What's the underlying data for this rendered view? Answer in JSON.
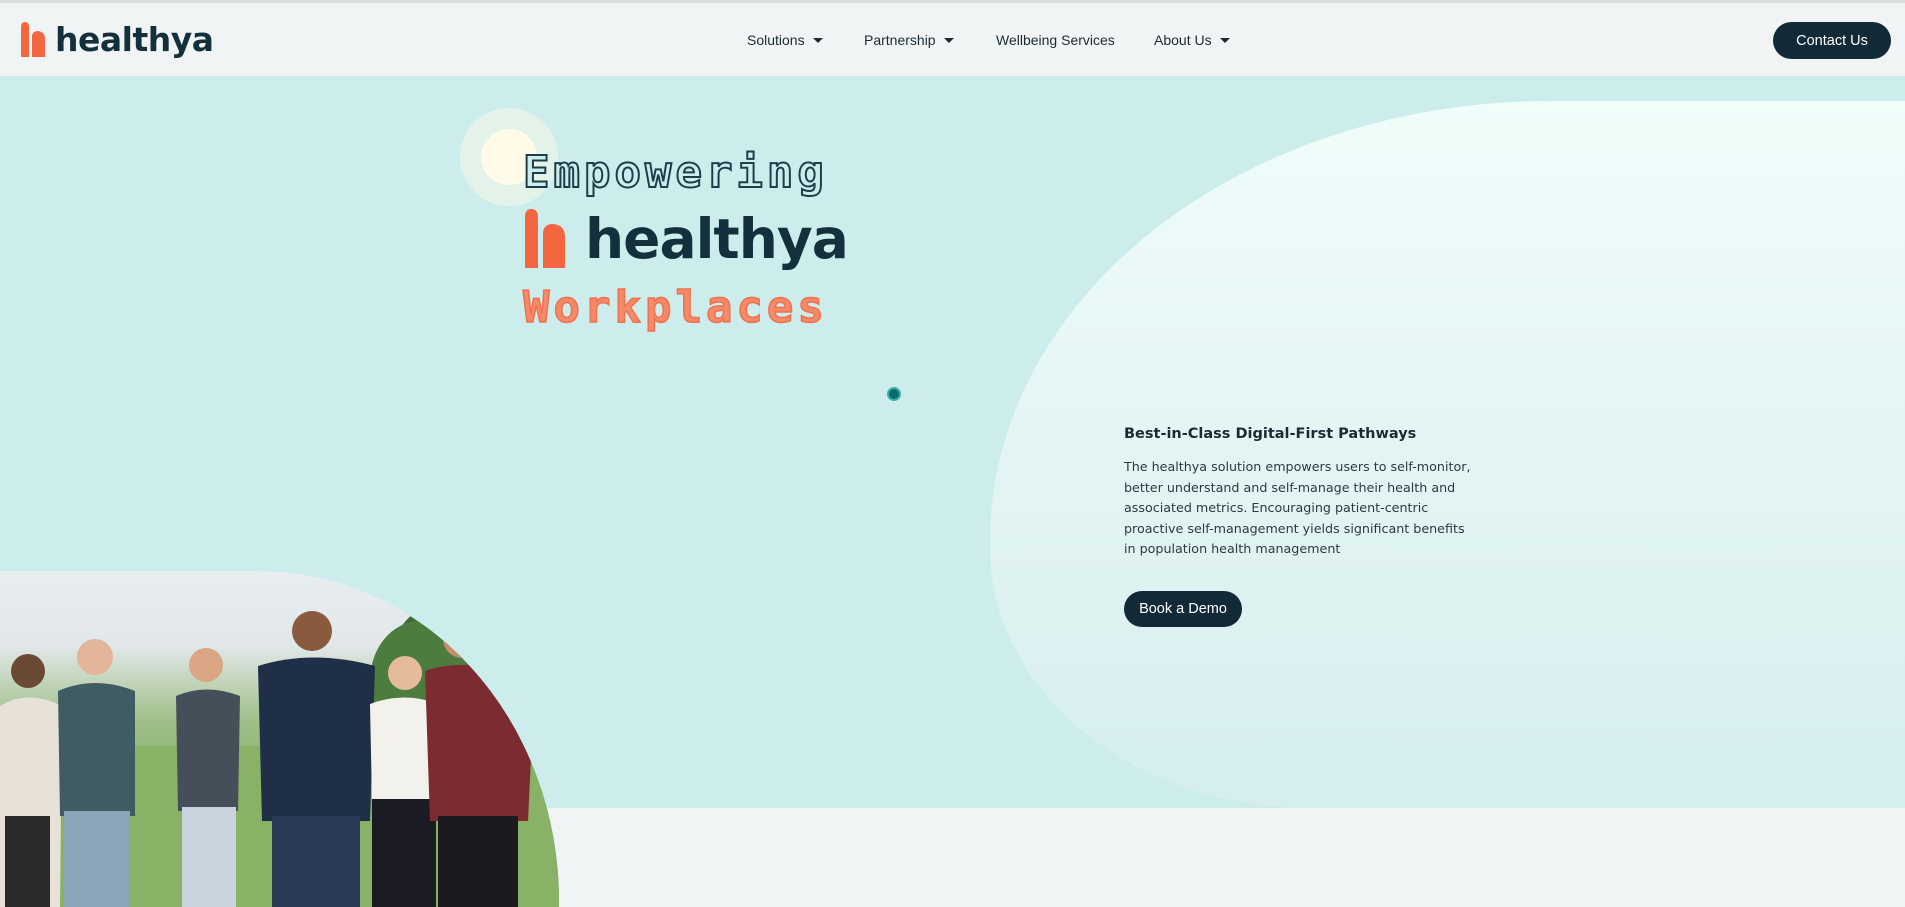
{
  "brand": {
    "name": "healthya",
    "primary": "#122a37",
    "accent": "#f26640",
    "hero_bg": "#cdeded",
    "page_bg": "#f0f4f4"
  },
  "nav": {
    "items": [
      {
        "label": "Solutions",
        "dropdown": true
      },
      {
        "label": "Partnership",
        "dropdown": true
      },
      {
        "label": "Wellbeing Services",
        "dropdown": false
      },
      {
        "label": "About Us",
        "dropdown": true
      }
    ],
    "contact_label": "Contact Us"
  },
  "hero": {
    "line1": "Empowering",
    "brand_line": "healthya",
    "line3": "Workplaces",
    "heading": "Best-in-Class Digital-First Pathways",
    "body": "The healthya solution empowers users to self-monitor, better understand and self-manage their health and associated metrics. Encouraging patient-centric proactive self-management yields significant benefits in population health management",
    "cta_label": "Book a Demo",
    "image_icon": "group-photo-people-outdoors"
  }
}
